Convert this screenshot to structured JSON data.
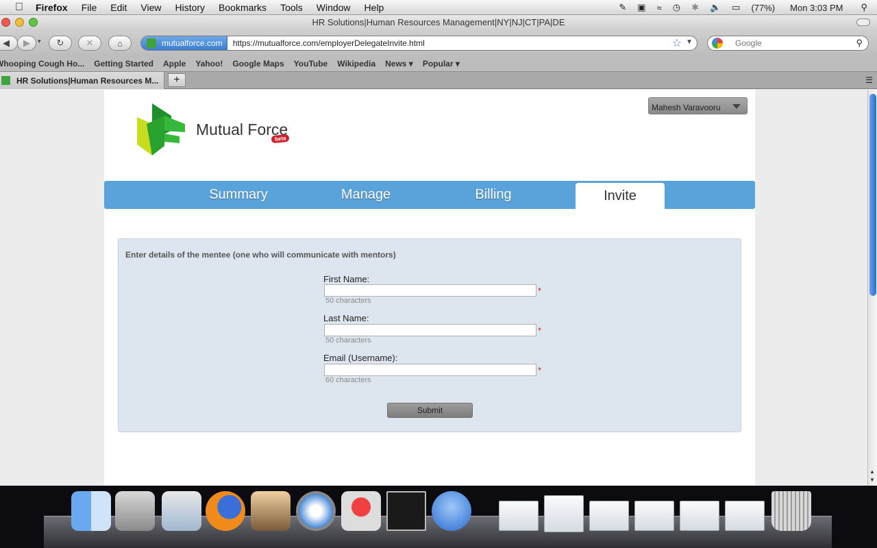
{
  "menubar": {
    "app": "Firefox",
    "items": [
      "File",
      "Edit",
      "View",
      "History",
      "Bookmarks",
      "Tools",
      "Window",
      "Help"
    ],
    "battery": "(77%)",
    "clock": "Mon 3:03 PM"
  },
  "window": {
    "title": "HR Solutions|Human Resources Management|NY|NJ|CT|PA|DE"
  },
  "toolbar": {
    "site_identity": "mutualforce.com",
    "url": "https://mutualforce.com/employerDelegateInvite.html",
    "search_placeholder": "Google"
  },
  "bookmarks": [
    "Whooping Cough Ho...",
    "Getting Started",
    "Apple",
    "Yahoo!",
    "Google Maps",
    "YouTube",
    "Wikipedia",
    "News ▾",
    "Popular ▾"
  ],
  "tabs": [
    {
      "label": "HR Solutions|Human Resources M..."
    }
  ],
  "page": {
    "brand": "Mutual Force",
    "beta_badge": "beta",
    "user_menu": "Mahesh Varavooru",
    "nav": {
      "summary": "Summary",
      "manage": "Manage",
      "billing": "Billing",
      "invite": "Invite"
    },
    "form": {
      "heading": "Enter details of the mentee (one who will communicate with mentors)",
      "first_name_label": "First Name:",
      "first_name_hint": "50 characters",
      "last_name_label": "Last Name:",
      "last_name_hint": "50 characters",
      "email_label": "Email (Username):",
      "email_hint": "60 characters",
      "required_mark": "*",
      "submit": "Submit"
    }
  },
  "colors": {
    "nav_blue": "#5aa2da",
    "form_bg": "#dde6ee",
    "logo_green": "#2aa22e",
    "logo_yellow": "#c8dc20",
    "required_red": "#d02020"
  },
  "dock_icons": [
    "finder-icon",
    "remote-desktop-icon",
    "utilities-icon",
    "firefox-icon",
    "iphoto-icon",
    "safari-icon",
    "record-icon",
    "terminal-icon",
    "openoffice-icon",
    "trash-icon"
  ]
}
